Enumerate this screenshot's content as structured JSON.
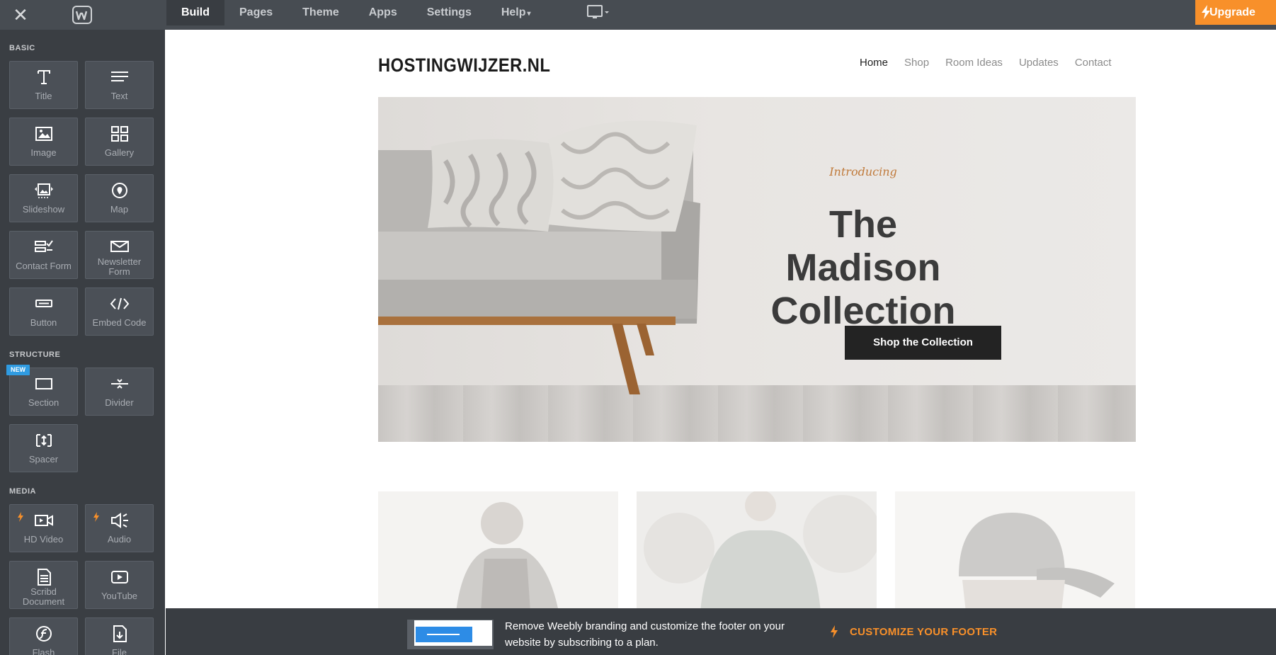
{
  "topbar": {
    "close_icon": "close-icon",
    "logo_icon": "weebly-logo-icon",
    "nav": [
      {
        "label": "Build",
        "active": true
      },
      {
        "label": "Pages",
        "active": false
      },
      {
        "label": "Theme",
        "active": false
      },
      {
        "label": "Apps",
        "active": false
      },
      {
        "label": "Settings",
        "active": false
      },
      {
        "label": "Help",
        "active": false
      }
    ],
    "help_caret": "▾",
    "device_icon": "desktop-icon",
    "upgrade_label": "Upgrade",
    "accent": "#f8902a"
  },
  "sidebar": {
    "basic_heading": "BASIC",
    "structure_heading": "STRUCTURE",
    "media_heading": "MEDIA",
    "new_badge": "NEW",
    "tiles": {
      "title": "Title",
      "text": "Text",
      "image": "Image",
      "gallery": "Gallery",
      "slideshow": "Slideshow",
      "map": "Map",
      "contact_form": "Contact Form",
      "newsletter_1": "Newsletter",
      "newsletter_2": "Form",
      "button": "Button",
      "embed_code": "Embed Code",
      "section": "Section",
      "divider": "Divider",
      "spacer": "Spacer",
      "hd_video": "HD Video",
      "audio": "Audio",
      "scribd_1": "Scribd",
      "scribd_2": "Document",
      "youtube": "YouTube",
      "flash": "Flash",
      "file": "File"
    }
  },
  "site": {
    "logo": "HOSTINGWIJZER.NL",
    "nav": [
      "Home",
      "Shop",
      "Room Ideas",
      "Updates",
      "Contact"
    ],
    "hero": {
      "intro": "Introducing",
      "title_line1": "The Madison",
      "title_line2": "Collection",
      "button": "Shop the Collection"
    }
  },
  "footer_bar": {
    "message_line1": "Remove Weebly branding and customize the footer on your",
    "message_line2": "website by subscribing to a plan.",
    "cta": "CUSTOMIZE YOUR FOOTER"
  }
}
